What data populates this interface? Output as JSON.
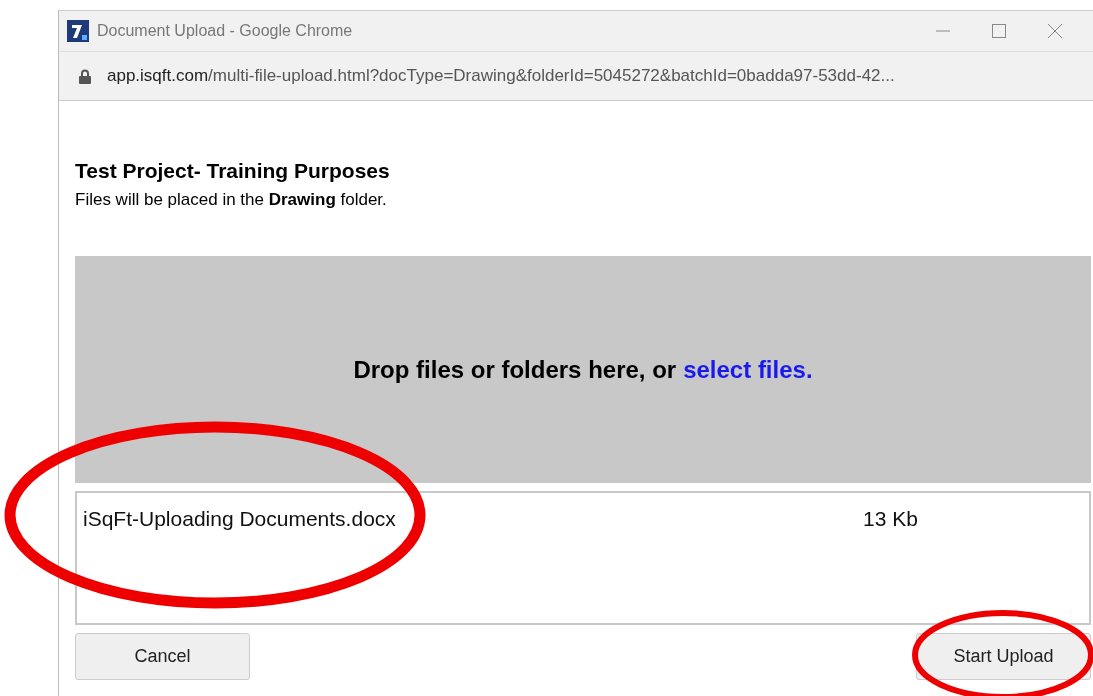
{
  "window": {
    "title": "Document Upload - Google Chrome",
    "url_host": "app.isqft.com",
    "url_path": "/multi-file-upload.html?docType=Drawing&folderId=5045272&batchId=0badda97-53dd-42..."
  },
  "project_title": "Test Project- Training Purposes",
  "folder_note": "Files will be placed in the **Drawing** folder.",
  "drop_zone": {
    "text": "Drop files or folders here, or",
    "link": "select files."
  },
  "files": [
    {
      "name": "iSqFt-Uploading Documents.docx",
      "size": "13 Kb"
    }
  ],
  "buttons": [
    {
      "label": "Cancel",
      "kind": "cancel"
    },
    {
      "label": "Start Upload",
      "kind": "start"
    }
  ],
  "annotations": [
    {
      "kind": "ellipse",
      "color": "#ee0000"
    },
    {
      "kind": "ellipse",
      "color": "#ee0000"
    }
  ]
}
